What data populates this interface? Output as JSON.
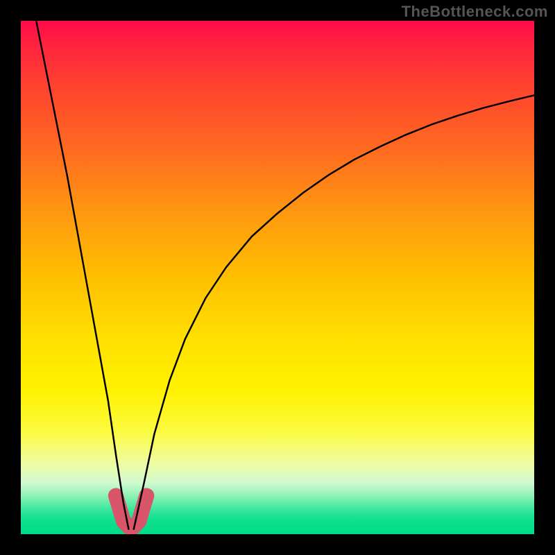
{
  "watermark": "TheBottleneck.com",
  "colors": {
    "frame_border": "#000000",
    "curve_stroke": "#000000",
    "highlight_stroke": "#d9556a",
    "gradient_top": "#ff0a4a",
    "gradient_bottom": "#00dc88"
  },
  "chart_data": {
    "type": "line",
    "title": "",
    "xlabel": "",
    "ylabel": "",
    "xlim": [
      0,
      1
    ],
    "ylim": [
      0,
      1
    ],
    "minimum_x": 0.215,
    "series": [
      {
        "name": "left-curve",
        "x": [
          0.03,
          0.05,
          0.07,
          0.09,
          0.11,
          0.13,
          0.15,
          0.17,
          0.186,
          0.2,
          0.21
        ],
        "values": [
          1.0,
          0.9,
          0.8,
          0.7,
          0.59,
          0.48,
          0.37,
          0.26,
          0.15,
          0.06,
          0.01
        ]
      },
      {
        "name": "right-curve",
        "x": [
          0.22,
          0.24,
          0.26,
          0.29,
          0.32,
          0.36,
          0.4,
          0.45,
          0.5,
          0.55,
          0.6,
          0.65,
          0.7,
          0.75,
          0.8,
          0.85,
          0.9,
          0.95,
          1.0
        ],
        "values": [
          0.01,
          0.1,
          0.195,
          0.3,
          0.38,
          0.46,
          0.52,
          0.58,
          0.625,
          0.665,
          0.7,
          0.73,
          0.755,
          0.778,
          0.798,
          0.815,
          0.83,
          0.843,
          0.855
        ]
      },
      {
        "name": "bottom-highlight",
        "x": [
          0.185,
          0.2,
          0.215,
          0.23,
          0.245
        ],
        "values": [
          0.075,
          0.025,
          0.01,
          0.025,
          0.075
        ]
      }
    ],
    "background_gradient": {
      "orientation": "vertical",
      "stops": [
        {
          "pos": 0.0,
          "color": "#ff0a4a"
        },
        {
          "pos": 0.25,
          "color": "#ff6a20"
        },
        {
          "pos": 0.5,
          "color": "#ffc000"
        },
        {
          "pos": 0.72,
          "color": "#fff200"
        },
        {
          "pos": 0.9,
          "color": "#d0fad0"
        },
        {
          "pos": 1.0,
          "color": "#00dc88"
        }
      ]
    }
  }
}
